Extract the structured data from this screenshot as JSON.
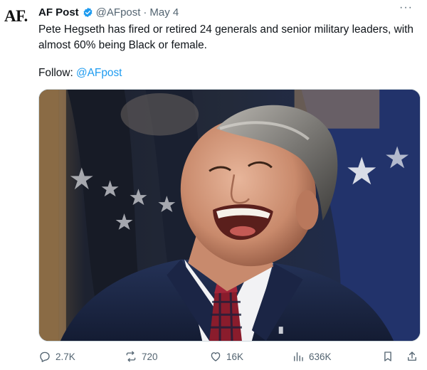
{
  "author": {
    "avatar_text": "AF.",
    "display_name": "AF Post",
    "handle": "@AFpost",
    "separator": "·",
    "date": "May 4",
    "verified": true
  },
  "tweet": {
    "text": "Pete Hegseth has fired or retired 24 generals and senior military leaders, with almost 60% being Black or female.",
    "follow_prefix": "Follow: ",
    "follow_mention": "@AFpost"
  },
  "media": {
    "description_icon": "photo"
  },
  "actions": {
    "replies": "2.7K",
    "reposts": "720",
    "likes": "16K",
    "views": "636K"
  },
  "colors": {
    "accent": "#1d9bf0",
    "muted": "#536471",
    "text": "#0f1419"
  },
  "icons": {
    "more": "more-horizontal-icon",
    "verified": "verified-badge-icon",
    "reply": "reply-icon",
    "repost": "repost-icon",
    "like": "heart-icon",
    "views": "bar-chart-icon",
    "bookmark": "bookmark-icon",
    "share": "share-icon"
  }
}
